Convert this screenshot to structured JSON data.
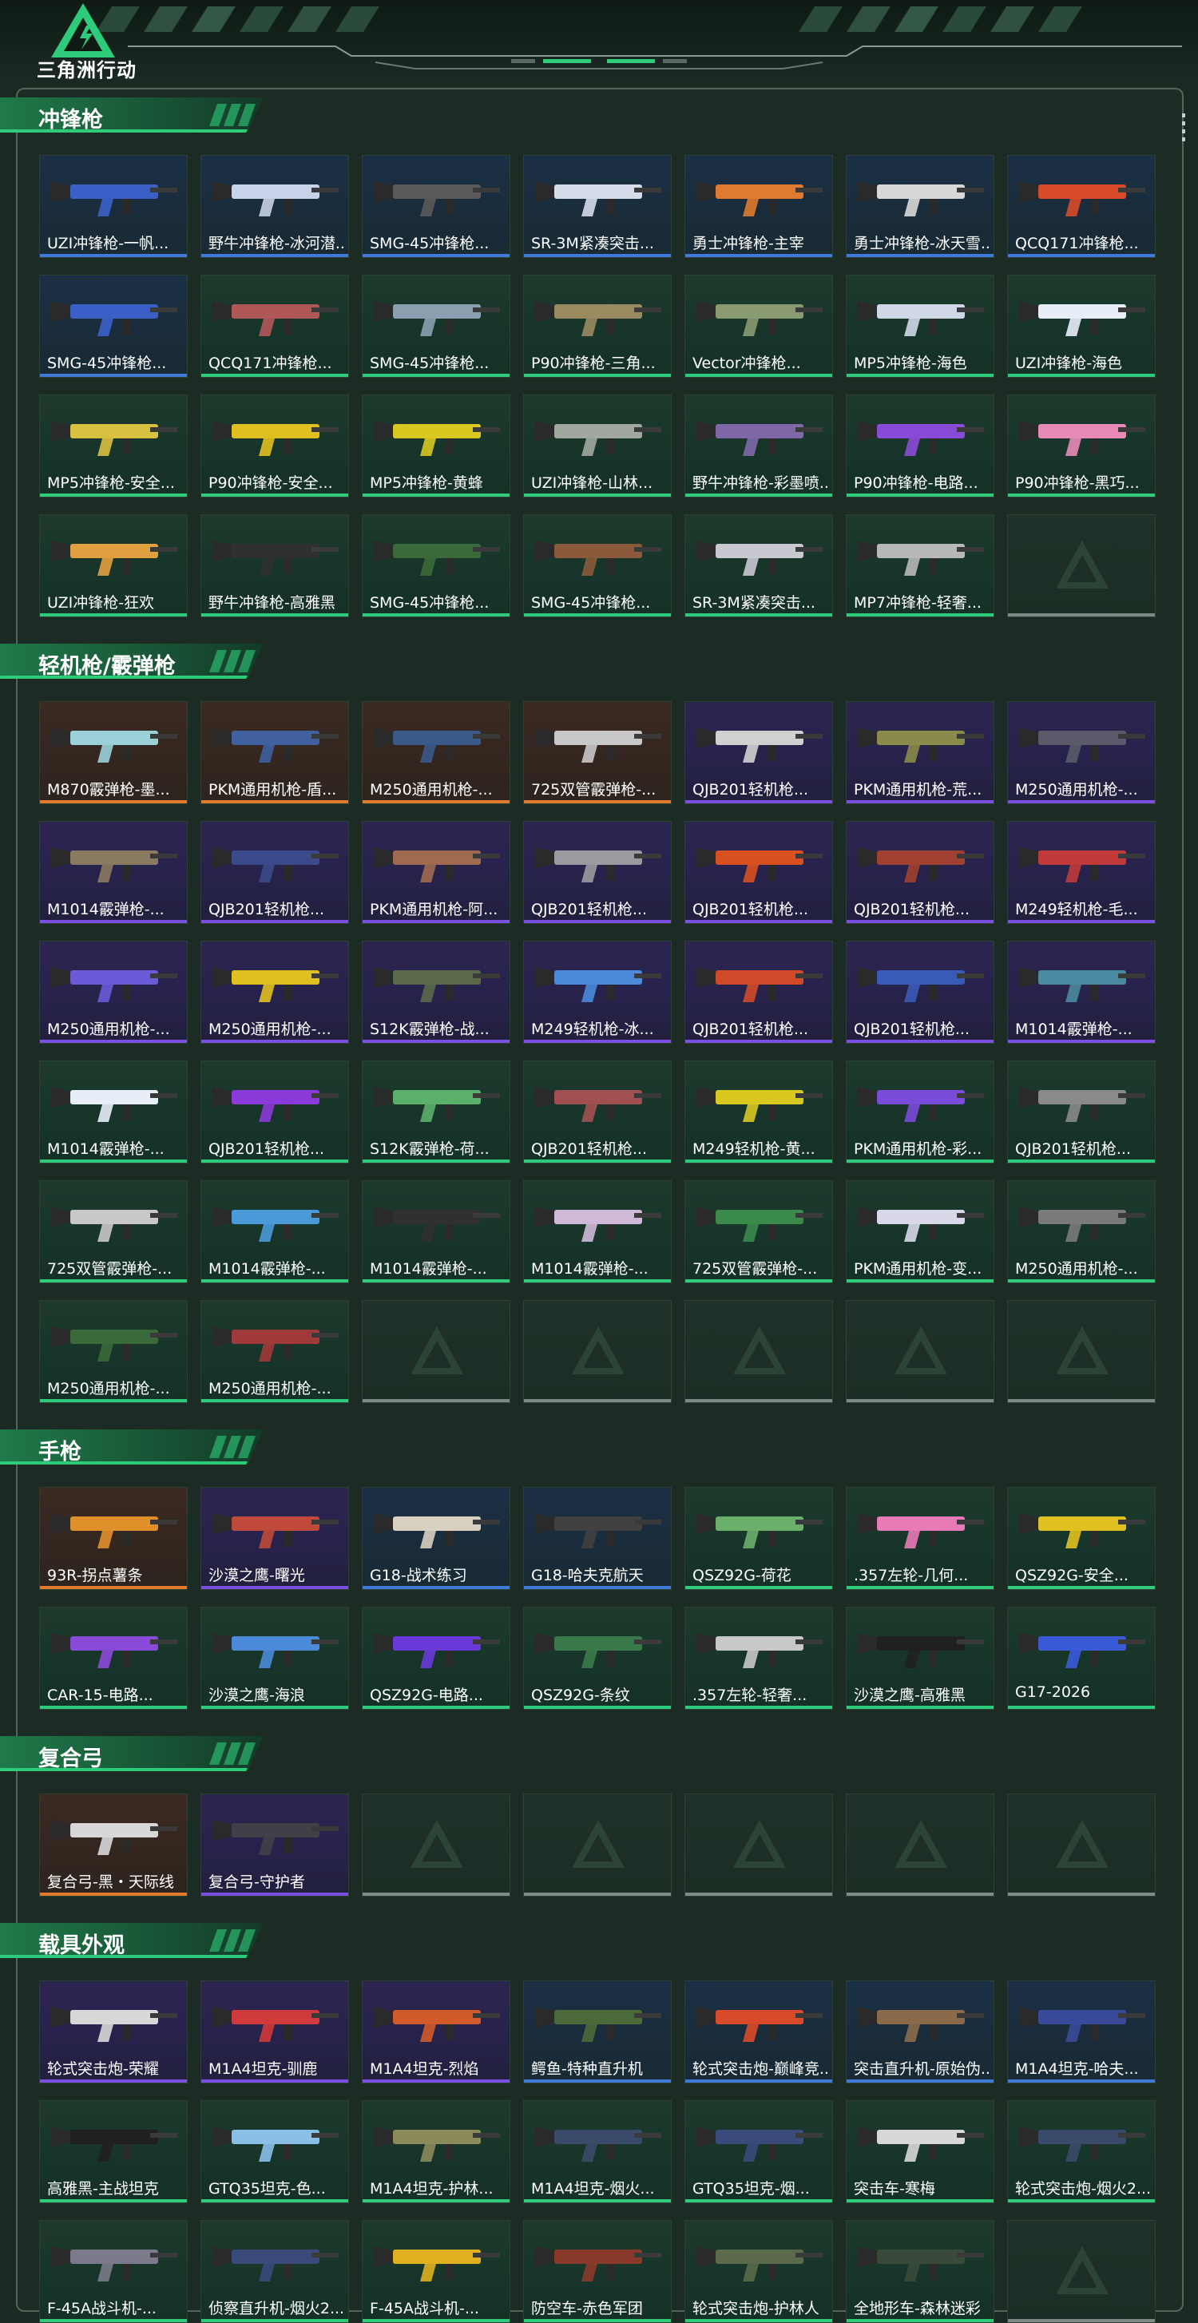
{
  "brand": {
    "name": "三角洲行动"
  },
  "colors": {
    "green": "#2ecb7a",
    "blue": "#3f7ad8",
    "purple": "#7b4fe0",
    "orange": "#e07a2f",
    "gray": "#7f8a86"
  },
  "sections": [
    {
      "title": "冲锋枪",
      "items": [
        {
          "name": "UZI冲锋枪-一帆...",
          "q": "blue",
          "c": "#3a60c8"
        },
        {
          "name": "野牛冲锋枪-冰河潜...",
          "q": "blue",
          "c": "#c8d2e8"
        },
        {
          "name": "SMG-45冲锋枪...",
          "q": "blue",
          "c": "#5a5a5a"
        },
        {
          "name": "SR-3M紧凑突击...",
          "q": "blue",
          "c": "#d6dcea"
        },
        {
          "name": "勇士冲锋枪-主宰",
          "q": "blue",
          "c": "#e07a2f"
        },
        {
          "name": "勇士冲锋枪-冰天雪...",
          "q": "blue",
          "c": "#d8d8d8"
        },
        {
          "name": "QCQ171冲锋枪...",
          "q": "blue",
          "c": "#d84a2a"
        },
        {
          "name": "SMG-45冲锋枪...",
          "q": "blue",
          "c": "#3a60c8"
        },
        {
          "name": "QCQ171冲锋枪...",
          "q": "green",
          "c": "#b05858"
        },
        {
          "name": "SMG-45冲锋枪...",
          "q": "green",
          "c": "#8aa0b0"
        },
        {
          "name": "P90冲锋枪-三角...",
          "q": "green",
          "c": "#9a8a60"
        },
        {
          "name": "Vector冲锋枪...",
          "q": "green",
          "c": "#8a9a70"
        },
        {
          "name": "MP5冲锋枪-海色",
          "q": "green",
          "c": "#d0d8e8"
        },
        {
          "name": "UZI冲锋枪-海色",
          "q": "green",
          "c": "#e8eef8"
        },
        {
          "name": "MP5冲锋枪-安全...",
          "q": "green",
          "c": "#d8c040"
        },
        {
          "name": "P90冲锋枪-安全...",
          "q": "green",
          "c": "#e0c020"
        },
        {
          "name": "MP5冲锋枪-黄蜂",
          "q": "green",
          "c": "#d8c820"
        },
        {
          "name": "UZI冲锋枪-山林...",
          "q": "green",
          "c": "#a0a8a0"
        },
        {
          "name": "野牛冲锋枪-彩墨喷...",
          "q": "green",
          "c": "#8068a8"
        },
        {
          "name": "P90冲锋枪-电路...",
          "q": "green",
          "c": "#8a4ad8"
        },
        {
          "name": "P90冲锋枪-黑巧...",
          "q": "green",
          "c": "#e88ab8"
        },
        {
          "name": "UZI冲锋枪-狂欢",
          "q": "green",
          "c": "#e0a040"
        },
        {
          "name": "野牛冲锋枪-高雅黑",
          "q": "green",
          "c": "#303030"
        },
        {
          "name": "SMG-45冲锋枪...",
          "q": "green",
          "c": "#3a6a3a"
        },
        {
          "name": "SMG-45冲锋枪...",
          "q": "green",
          "c": "#8a5a3a"
        },
        {
          "name": "SR-3M紧凑突击...",
          "q": "green",
          "c": "#c8c8d0"
        },
        {
          "name": "MP7冲锋枪-轻奢...",
          "q": "green",
          "c": "#b8b8b8"
        },
        {
          "name": "",
          "q": "empty"
        }
      ]
    },
    {
      "title": "轻机枪/霰弹枪",
      "items": [
        {
          "name": "M870霰弹枪-墨...",
          "q": "orange",
          "c": "#9ad0d8"
        },
        {
          "name": "PKM通用机枪-盾...",
          "q": "orange",
          "c": "#4060a0"
        },
        {
          "name": "M250通用机枪-...",
          "q": "orange",
          "c": "#3a5a8a"
        },
        {
          "name": "725双管霰弹枪-...",
          "q": "orange",
          "c": "#c8c8c8"
        },
        {
          "name": "QJB201轻机枪...",
          "q": "purple",
          "c": "#d0d0d0"
        },
        {
          "name": "PKM通用机枪-荒...",
          "q": "purple",
          "c": "#8a8a4a"
        },
        {
          "name": "M250通用机枪-...",
          "q": "purple",
          "c": "#5a5a6a"
        },
        {
          "name": "M1014霰弹枪-...",
          "q": "purple",
          "c": "#8a7a60"
        },
        {
          "name": "QJB201轻机枪...",
          "q": "purple",
          "c": "#3a4a8a"
        },
        {
          "name": "PKM通用机枪-阿...",
          "q": "purple",
          "c": "#a06a50"
        },
        {
          "name": "QJB201轻机枪...",
          "q": "purple",
          "c": "#9a9aa0"
        },
        {
          "name": "QJB201轻机枪...",
          "q": "purple",
          "c": "#d85020"
        },
        {
          "name": "QJB201轻机枪...",
          "q": "purple",
          "c": "#a04030"
        },
        {
          "name": "M249轻机枪-毛...",
          "q": "purple",
          "c": "#c03a3a"
        },
        {
          "name": "M250通用机枪-...",
          "q": "purple",
          "c": "#6a5ad8"
        },
        {
          "name": "M250通用机枪-...",
          "q": "purple",
          "c": "#e0c020"
        },
        {
          "name": "S12K霰弹枪-战...",
          "q": "purple",
          "c": "#5a6a4a"
        },
        {
          "name": "M249轻机枪-冰...",
          "q": "purple",
          "c": "#4a8ad8"
        },
        {
          "name": "QJB201轻机枪...",
          "q": "purple",
          "c": "#d04a2a"
        },
        {
          "name": "QJB201轻机枪...",
          "q": "purple",
          "c": "#3a5ab8"
        },
        {
          "name": "M1014霰弹枪-...",
          "q": "purple",
          "c": "#4a8aa0"
        },
        {
          "name": "M1014霰弹枪-...",
          "q": "green",
          "c": "#e8eef8"
        },
        {
          "name": "QJB201轻机枪...",
          "q": "green",
          "c": "#8a3ad8"
        },
        {
          "name": "S12K霰弹枪-荷...",
          "q": "green",
          "c": "#5ab06a"
        },
        {
          "name": "QJB201轻机枪...",
          "q": "green",
          "c": "#a05050"
        },
        {
          "name": "M249轻机枪-黄...",
          "q": "green",
          "c": "#d8c820"
        },
        {
          "name": "PKM通用机枪-彩...",
          "q": "green",
          "c": "#7a4ad8"
        },
        {
          "name": "QJB201轻机枪...",
          "q": "green",
          "c": "#8a8a8a"
        },
        {
          "name": "725双管霰弹枪-...",
          "q": "green",
          "c": "#c8c8c8"
        },
        {
          "name": "M1014霰弹枪-...",
          "q": "green",
          "c": "#4a9ad8"
        },
        {
          "name": "M1014霰弹枪-...",
          "q": "green",
          "c": "#303030"
        },
        {
          "name": "M1014霰弹枪-...",
          "q": "green",
          "c": "#d0b8d8"
        },
        {
          "name": "725双管霰弹枪-...",
          "q": "green",
          "c": "#3a8a4a"
        },
        {
          "name": "PKM通用机枪-变...",
          "q": "green",
          "c": "#d8d8e8"
        },
        {
          "name": "M250通用机枪-...",
          "q": "green",
          "c": "#7a7a7a"
        },
        {
          "name": "M250通用机枪-...",
          "q": "green",
          "c": "#3a6a3a"
        },
        {
          "name": "M250通用机枪-...",
          "q": "green",
          "c": "#a03a3a"
        },
        {
          "name": "",
          "q": "empty"
        },
        {
          "name": "",
          "q": "empty"
        },
        {
          "name": "",
          "q": "empty"
        },
        {
          "name": "",
          "q": "empty"
        },
        {
          "name": "",
          "q": "empty"
        }
      ]
    },
    {
      "title": "手枪",
      "items": [
        {
          "name": "93R-拐点薯条",
          "q": "orange",
          "c": "#e0902a"
        },
        {
          "name": "沙漠之鹰-曙光",
          "q": "purple",
          "c": "#c04a3a"
        },
        {
          "name": "G18-战术练习",
          "q": "blue",
          "c": "#d8d0c0"
        },
        {
          "name": "G18-哈夫克航天",
          "q": "blue",
          "c": "#404040"
        },
        {
          "name": "QSZ92G-荷花",
          "q": "green",
          "c": "#6ab06a"
        },
        {
          "name": ".357左轮-几何...",
          "q": "green",
          "c": "#e87ab8"
        },
        {
          "name": "QSZ92G-安全...",
          "q": "green",
          "c": "#e0c020"
        },
        {
          "name": "CAR-15-电路...",
          "q": "green",
          "c": "#8a4ad8"
        },
        {
          "name": "沙漠之鹰-海浪",
          "q": "green",
          "c": "#4a8ad8"
        },
        {
          "name": "QSZ92G-电路...",
          "q": "green",
          "c": "#6a3ad8"
        },
        {
          "name": "QSZ92G-条纹",
          "q": "green",
          "c": "#3a7a4a"
        },
        {
          "name": ".357左轮-轻奢...",
          "q": "green",
          "c": "#c8c8c8"
        },
        {
          "name": "沙漠之鹰-高雅黑",
          "q": "green",
          "c": "#202020"
        },
        {
          "name": "G17-2026",
          "q": "green",
          "c": "#3a5ad8"
        }
      ]
    },
    {
      "title": "复合弓",
      "items": [
        {
          "name": "复合弓-黑・天际线",
          "q": "orange",
          "c": "#d8d8d8"
        },
        {
          "name": "复合弓-守护者",
          "q": "purple",
          "c": "#404048"
        },
        {
          "name": "",
          "q": "empty"
        },
        {
          "name": "",
          "q": "empty"
        },
        {
          "name": "",
          "q": "empty"
        },
        {
          "name": "",
          "q": "empty"
        },
        {
          "name": "",
          "q": "empty"
        }
      ]
    },
    {
      "title": "载具外观",
      "items": [
        {
          "name": "轮式突击炮-荣耀",
          "q": "purple",
          "c": "#d8d8d8"
        },
        {
          "name": "M1A4坦克-驯鹿",
          "q": "purple",
          "c": "#d03a3a"
        },
        {
          "name": "M1A4坦克-烈焰",
          "q": "purple",
          "c": "#d05a2a"
        },
        {
          "name": "鳄鱼-特种直升机",
          "q": "blue",
          "c": "#4a6a3a"
        },
        {
          "name": "轮式突击炮-巅峰竞...",
          "q": "blue",
          "c": "#d84a2a"
        },
        {
          "name": "突击直升机-原始伪...",
          "q": "blue",
          "c": "#8a6a4a"
        },
        {
          "name": "M1A4坦克-哈夫...",
          "q": "blue",
          "c": "#3a4a9a"
        },
        {
          "name": "高雅黑-主战坦克",
          "q": "green",
          "c": "#202020"
        },
        {
          "name": "GTQ35坦克-色...",
          "q": "green",
          "c": "#8ac0e8"
        },
        {
          "name": "M1A4坦克-护林...",
          "q": "green",
          "c": "#8a8a5a"
        },
        {
          "name": "M1A4坦克-烟火...",
          "q": "green",
          "c": "#3a4a6a"
        },
        {
          "name": "GTQ35坦克-烟...",
          "q": "green",
          "c": "#3a4a7a"
        },
        {
          "name": "突击车-寒梅",
          "q": "green",
          "c": "#d8d8d8"
        },
        {
          "name": "轮式突击炮-烟火2...",
          "q": "green",
          "c": "#3a4a6a"
        },
        {
          "name": "F-45A战斗机-...",
          "q": "green",
          "c": "#7a7a8a"
        },
        {
          "name": "侦察直升机-烟火2...",
          "q": "green",
          "c": "#3a4a7a"
        },
        {
          "name": "F-45A战斗机-...",
          "q": "green",
          "c": "#e0b020"
        },
        {
          "name": "防空车-赤色军团",
          "q": "green",
          "c": "#8a3a2a"
        },
        {
          "name": "轮式突击炮-护林人",
          "q": "green",
          "c": "#5a6a4a"
        },
        {
          "name": "全地形车-森林迷彩",
          "q": "green",
          "c": "#3a4a3a"
        },
        {
          "name": "",
          "q": "empty"
        }
      ]
    }
  ]
}
